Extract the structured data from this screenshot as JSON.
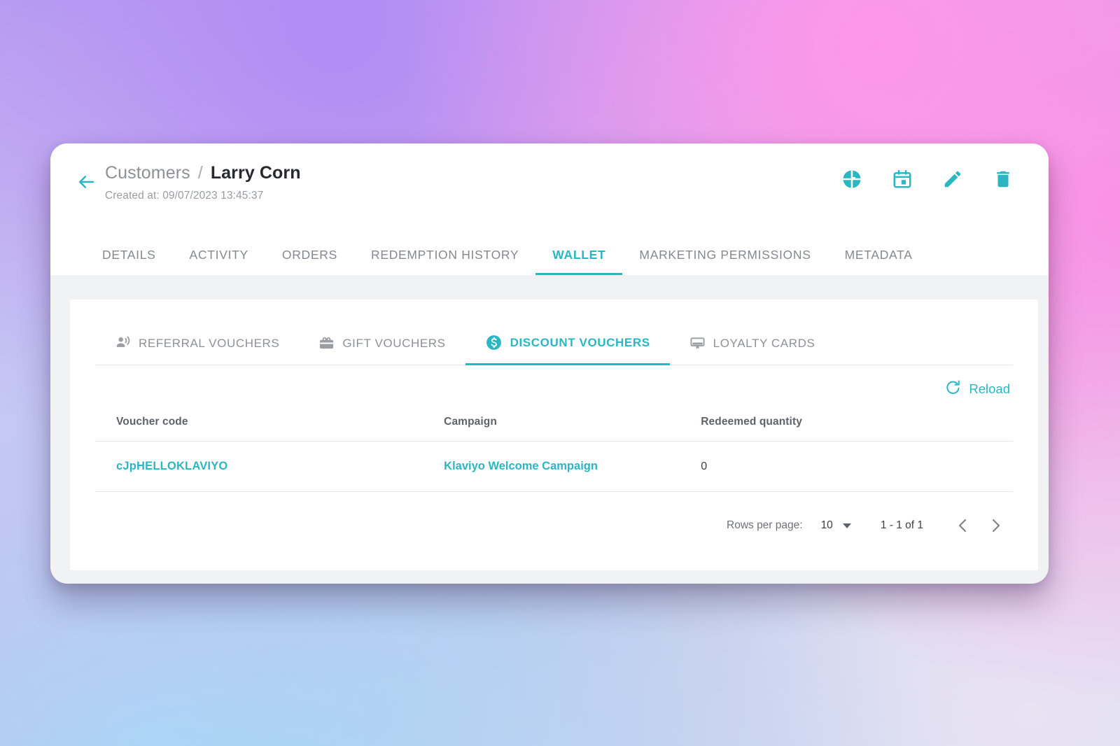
{
  "header": {
    "back_icon": "arrow-left-icon",
    "breadcrumb_parent": "Customers",
    "breadcrumb_separator": "/",
    "breadcrumb_current": "Larry Corn",
    "created_at": "Created at: 09/07/2023 13:45:37",
    "actions": [
      {
        "name": "analytics-pie-chart-icon",
        "title": "Analytics"
      },
      {
        "name": "calendar-icon",
        "title": "Calendar"
      },
      {
        "name": "edit-pencil-icon",
        "title": "Edit"
      },
      {
        "name": "delete-trash-icon",
        "title": "Delete"
      }
    ]
  },
  "main_tabs": [
    {
      "label": "DETAILS",
      "active": false
    },
    {
      "label": "ACTIVITY",
      "active": false
    },
    {
      "label": "ORDERS",
      "active": false
    },
    {
      "label": "REDEMPTION HISTORY",
      "active": false
    },
    {
      "label": "WALLET",
      "active": true
    },
    {
      "label": "MARKETING PERMISSIONS",
      "active": false
    },
    {
      "label": "METADATA",
      "active": false
    }
  ],
  "sub_tabs": [
    {
      "label": "REFERRAL VOUCHERS",
      "icon": "record-voice-over-icon",
      "active": false
    },
    {
      "label": "GIFT VOUCHERS",
      "icon": "card-giftcard-icon",
      "active": false
    },
    {
      "label": "DISCOUNT VOUCHERS",
      "icon": "monetization-on-icon",
      "active": true
    },
    {
      "label": "LOYALTY CARDS",
      "icon": "loyalty-card-icon",
      "active": false
    }
  ],
  "toolbar": {
    "reload_label": "Reload",
    "reload_icon": "refresh-icon"
  },
  "table": {
    "columns": [
      "Voucher code",
      "Campaign",
      "Redeemed quantity"
    ],
    "rows": [
      {
        "voucher_code": "cJpHELLOKLAVIYO",
        "campaign": "Klaviyo Welcome Campaign",
        "redeemed_quantity": "0"
      }
    ]
  },
  "pagination": {
    "rows_per_page_label": "Rows per page:",
    "rows_per_page_value": "10",
    "range_label": "1 - 1 of 1",
    "prev_icon": "chevron-left-icon",
    "next_icon": "chevron-right-icon"
  },
  "colors": {
    "accent": "#2bb6c4",
    "text_primary": "#26292d",
    "text_muted": "#8d9196",
    "panel_bg": "#ffffff",
    "window_bg": "#f1f2f4"
  }
}
